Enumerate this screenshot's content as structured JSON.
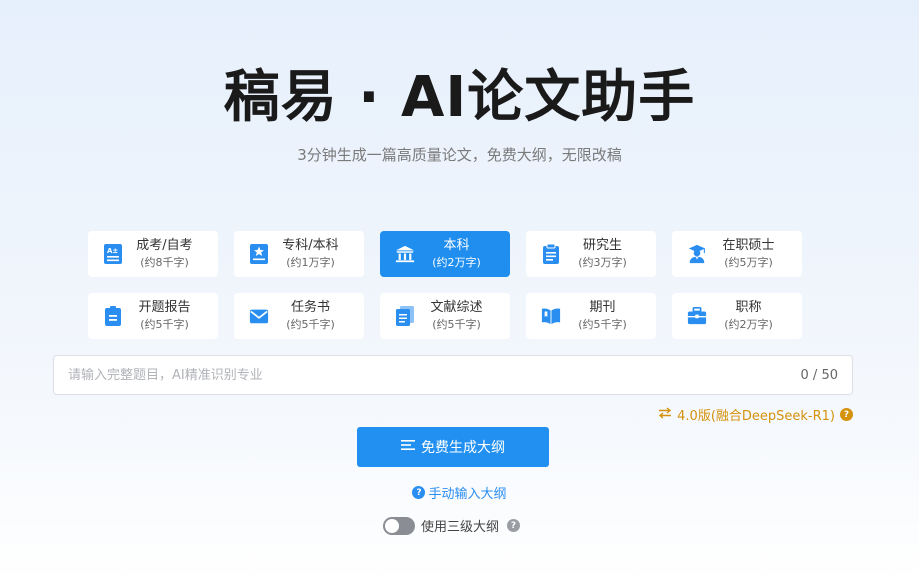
{
  "header": {
    "logo_text_1": "稿易",
    "logo_dot": "·",
    "logo_text_2": "AI论文助手",
    "subtitle": "3分钟生成一篇高质量论文，免费大纲，无限改稿"
  },
  "paper_types": [
    {
      "name": "成考/自考",
      "words": "(约8千字)",
      "icon": "document-a-icon",
      "active": false
    },
    {
      "name": "专科/本科",
      "words": "(约1万字)",
      "icon": "star-document-icon",
      "active": false
    },
    {
      "name": "本科",
      "words": "(约2万字)",
      "icon": "institution-icon",
      "active": true
    },
    {
      "name": "研究生",
      "words": "(约3万字)",
      "icon": "clipboard-icon",
      "active": false
    },
    {
      "name": "在职硕士",
      "words": "(约5万字)",
      "icon": "graduate-icon",
      "active": false
    },
    {
      "name": "开题报告",
      "words": "(约5千字)",
      "icon": "report-icon",
      "active": false
    },
    {
      "name": "任务书",
      "words": "(约5千字)",
      "icon": "envelope-icon",
      "active": false
    },
    {
      "name": "文献综述",
      "words": "(约5千字)",
      "icon": "files-icon",
      "active": false
    },
    {
      "name": "期刊",
      "words": "(约5千字)",
      "icon": "book-icon",
      "active": false
    },
    {
      "name": "职称",
      "words": "(约2万字)",
      "icon": "briefcase-icon",
      "active": false
    }
  ],
  "topic_input": {
    "placeholder": "请输入完整题目，AI精准识别专业",
    "value": "",
    "counter": "0 / 50"
  },
  "version": {
    "label": "4.0版(融合DeepSeek-R1)"
  },
  "generate_button": {
    "label": "免费生成大纲"
  },
  "manual_link": {
    "label": "手动输入大纲"
  },
  "three_level_outline": {
    "label": "使用三级大纲",
    "enabled": false
  },
  "colors": {
    "accent": "#1f8eef",
    "version_gold": "#d4920d",
    "icon_blue": "#2a8ef0"
  }
}
